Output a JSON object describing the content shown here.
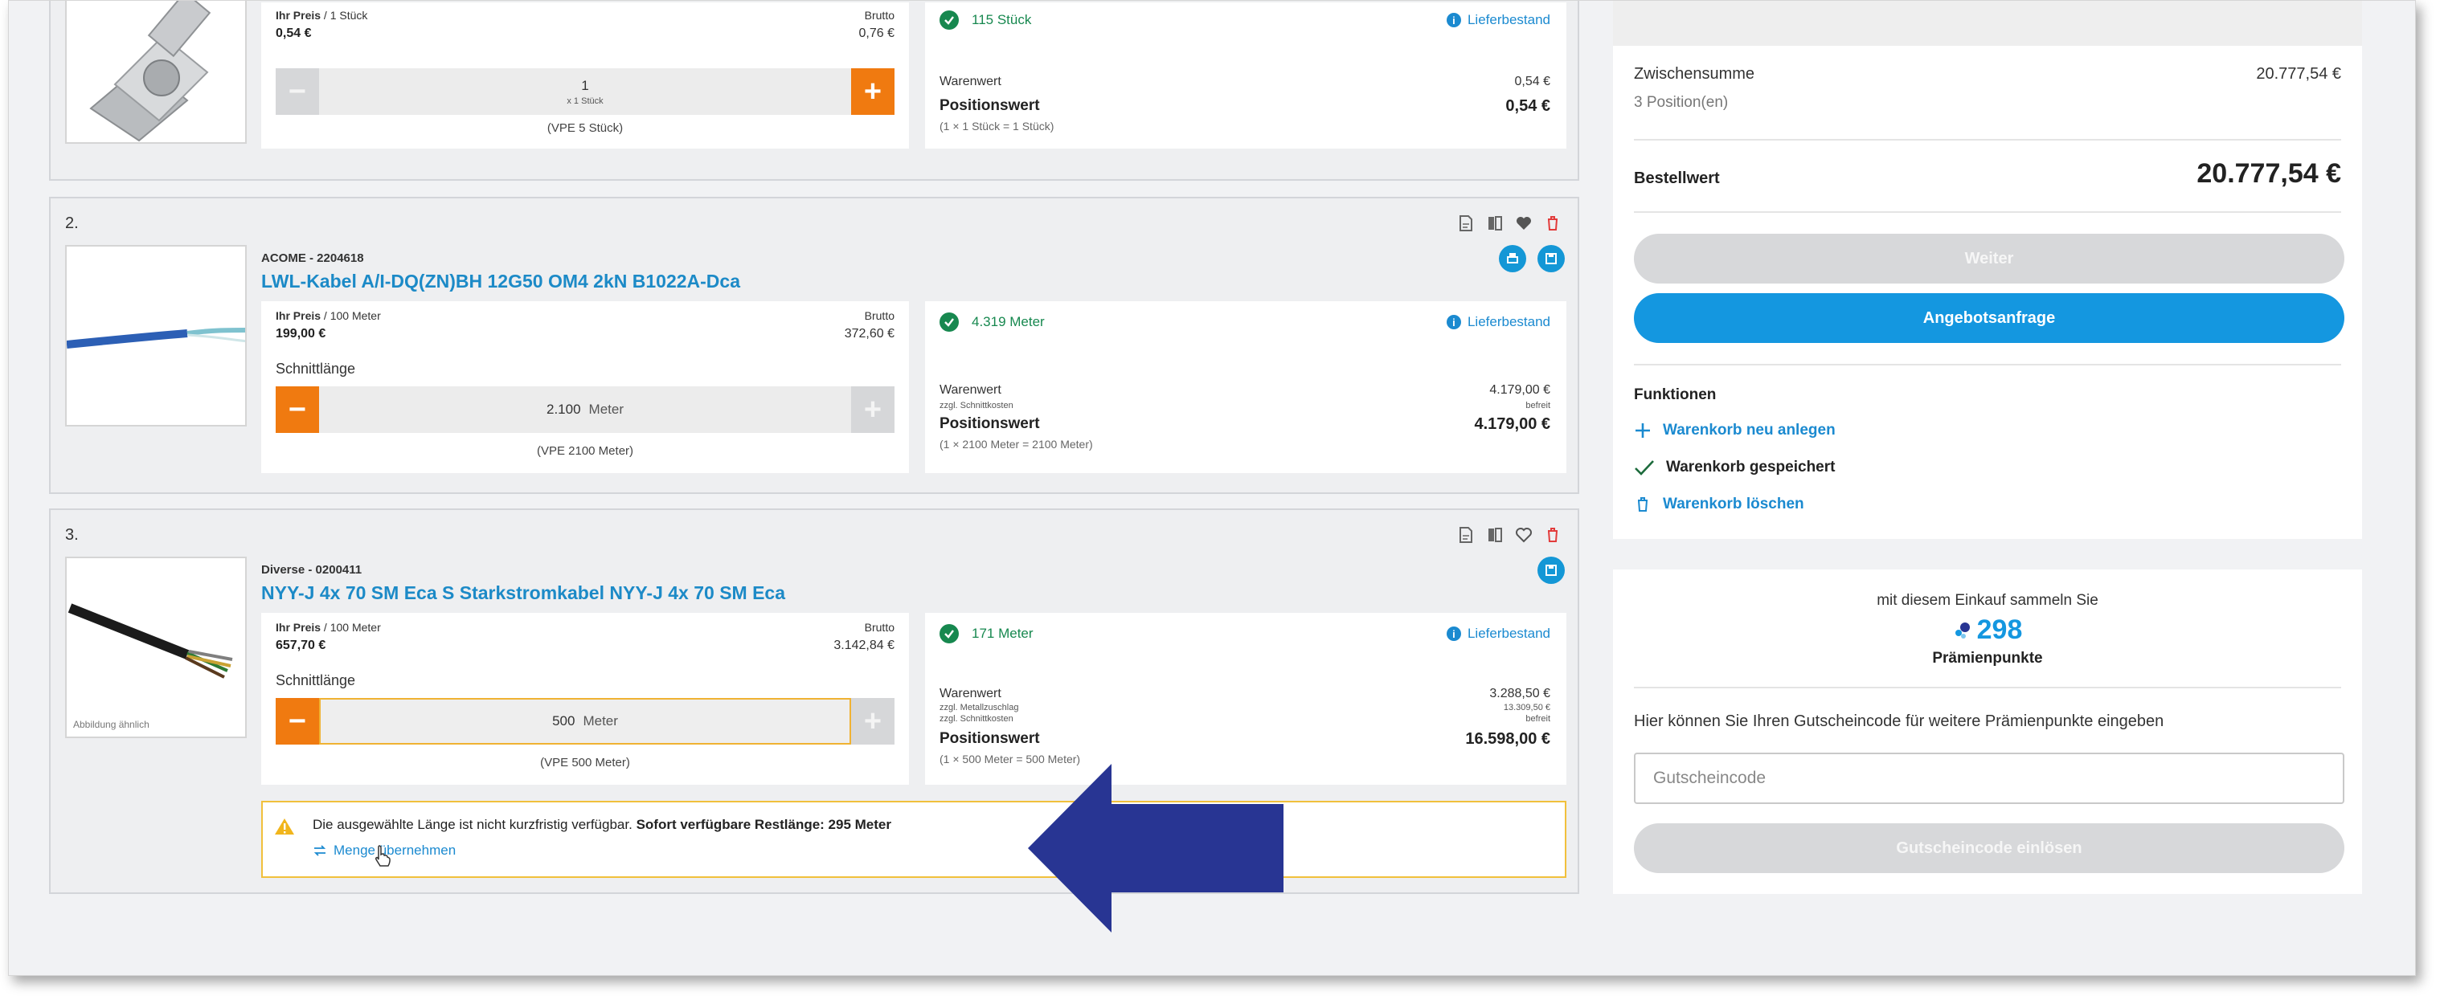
{
  "items": [
    {
      "index": "",
      "price": {
        "label": "Ihr Preis",
        "unit": " / 1 Stück",
        "value": "0,54 €",
        "brutto_label": "Brutto",
        "brutto_value": "0,76 €"
      },
      "qty": {
        "value": "1",
        "sub": "x 1 Stück",
        "vpe": "(VPE 5 Stück)"
      },
      "stock": {
        "text": "115 Stück",
        "link": "Lieferbestand"
      },
      "summary": {
        "warenwert_label": "Warenwert",
        "warenwert_value": "0,54 €",
        "positionswert_label": "Positionswert",
        "positionswert_value": "0,54 €",
        "formula": "(1 × 1 Stück = 1 Stück)"
      }
    },
    {
      "index": "2.",
      "sku": "ACOME - 2204618",
      "title": "LWL-Kabel A/I-DQ(ZN)BH 12G50 OM4 2kN B1022A-Dca",
      "price": {
        "label": "Ihr Preis",
        "unit": " / 100 Meter",
        "value": "199,00 €",
        "brutto_label": "Brutto",
        "brutto_value": "372,60 €"
      },
      "schnitt_label": "Schnittlänge",
      "qty": {
        "value": "2.100",
        "unit": "Meter",
        "vpe": "(VPE 2100 Meter)"
      },
      "stock": {
        "text": "4.319 Meter",
        "link": "Lieferbestand"
      },
      "summary": {
        "warenwert_label": "Warenwert",
        "warenwert_value": "4.179,00 €",
        "extra1_label": "zzgl. Schnittkosten",
        "extra1_value": "befreit",
        "positionswert_label": "Positionswert",
        "positionswert_value": "4.179,00 €",
        "formula": "(1 × 2100 Meter = 2100 Meter)"
      }
    },
    {
      "index": "3.",
      "sku": "Diverse - 0200411",
      "title": "NYY-J 4x 70 SM Eca S Starkstromkabel NYY-J 4x 70 SM Eca",
      "image_note": "Abbildung ähnlich",
      "price": {
        "label": "Ihr Preis",
        "unit": " / 100 Meter",
        "value": "657,70 €",
        "brutto_label": "Brutto",
        "brutto_value": "3.142,84 €"
      },
      "schnitt_label": "Schnittlänge",
      "qty": {
        "value": "500",
        "unit": "Meter",
        "vpe": "(VPE 500 Meter)"
      },
      "stock": {
        "text": "171 Meter",
        "link": "Lieferbestand"
      },
      "summary": {
        "warenwert_label": "Warenwert",
        "warenwert_value": "3.288,50 €",
        "extra1_label": "zzgl. Metallzuschlag",
        "extra1_value": "13.309,50 €",
        "extra2_label": "zzgl. Schnittkosten",
        "extra2_value": "befreit",
        "positionswert_label": "Positionswert",
        "positionswert_value": "16.598,00 €",
        "formula": "(1 × 500 Meter = 500 Meter)"
      },
      "warning": {
        "text": "Die ausgewählte Länge ist nicht kurzfristig verfügbar.",
        "bold": "Sofort verfügbare Restlänge: 295 Meter",
        "link": "Menge übernehmen"
      }
    }
  ],
  "summary": {
    "zwischensumme_label": "Zwischensumme",
    "zwischensumme_value": "20.777,54 €",
    "positions": "3 Position(en)",
    "bestellwert_label": "Bestellwert",
    "bestellwert_value": "20.777,54 €",
    "weiter": "Weiter",
    "angebot": "Angebotsanfrage",
    "funktionen": "Funktionen",
    "neu_anlegen": "Warenkorb neu anlegen",
    "gespeichert": "Warenkorb gespeichert",
    "loeschen": "Warenkorb löschen"
  },
  "points": {
    "intro": "mit diesem Einkauf sammeln Sie",
    "value": "298",
    "label": "Prämienpunkte",
    "hint": "Hier können Sie Ihren Gutscheincode für weitere Prämienpunkte eingeben",
    "placeholder": "Gutscheincode",
    "redeem": "Gutscheincode einlösen"
  },
  "colors": {
    "accent_blue": "#1497e0",
    "orange": "#f07a10",
    "green": "#17884f",
    "arrow": "#283593",
    "warn": "#f1c03c"
  }
}
